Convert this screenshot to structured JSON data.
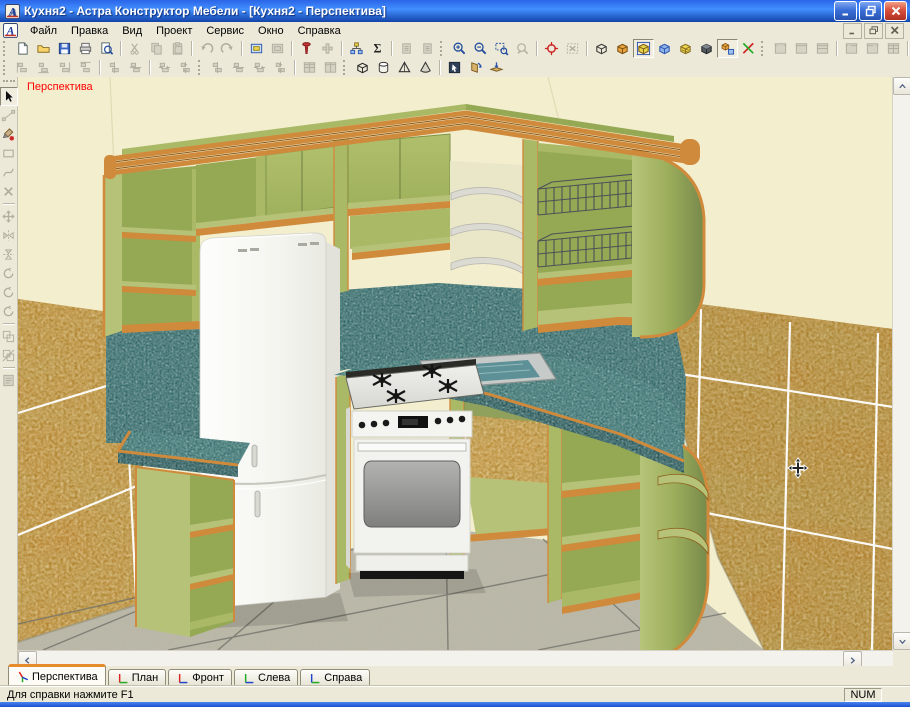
{
  "window": {
    "title": "Кухня2 - Астра Конструктор Мебели - [Кухня2 - Перспектива]"
  },
  "menu": {
    "items": [
      {
        "name": "file",
        "label": "Файл"
      },
      {
        "name": "edit",
        "label": "Правка"
      },
      {
        "name": "view",
        "label": "Вид"
      },
      {
        "name": "project",
        "label": "Проект"
      },
      {
        "name": "service",
        "label": "Сервис"
      },
      {
        "name": "window",
        "label": "Окно"
      },
      {
        "name": "help",
        "label": "Справка"
      }
    ]
  },
  "toolbars": {
    "main": [
      {
        "k": "grip"
      },
      {
        "k": "btn",
        "name": "new",
        "icon": "doc",
        "on": true
      },
      {
        "k": "btn",
        "name": "open",
        "icon": "folder",
        "on": true
      },
      {
        "k": "btn",
        "name": "save",
        "icon": "floppy",
        "on": true
      },
      {
        "k": "btn",
        "name": "print",
        "icon": "printer",
        "on": true
      },
      {
        "k": "btn",
        "name": "print-preview",
        "icon": "preview",
        "on": true
      },
      {
        "k": "sep"
      },
      {
        "k": "btn",
        "name": "cut",
        "icon": "scissors",
        "on": false
      },
      {
        "k": "btn",
        "name": "copy",
        "icon": "copy",
        "on": false
      },
      {
        "k": "btn",
        "name": "paste",
        "icon": "paste",
        "on": false
      },
      {
        "k": "sep"
      },
      {
        "k": "btn",
        "name": "undo",
        "icon": "undo",
        "on": false
      },
      {
        "k": "btn",
        "name": "redo",
        "icon": "redo",
        "on": false
      },
      {
        "k": "sep"
      },
      {
        "k": "btn",
        "name": "edit-material",
        "icon": "panel",
        "on": true
      },
      {
        "k": "btn",
        "name": "edit-material-2",
        "icon": "panel",
        "on": false
      },
      {
        "k": "sep"
      },
      {
        "k": "btn",
        "name": "fasteners",
        "icon": "screw",
        "on": true
      },
      {
        "k": "btn",
        "name": "fittings",
        "icon": "fitting",
        "on": false
      },
      {
        "k": "sep"
      },
      {
        "k": "btn",
        "name": "structure",
        "icon": "structure",
        "on": true
      },
      {
        "k": "btn",
        "name": "calc-sum",
        "icon": "sum",
        "on": true
      },
      {
        "k": "sep"
      },
      {
        "k": "btn",
        "name": "report-a",
        "icon": "doc2",
        "on": false
      },
      {
        "k": "btn",
        "name": "report-b",
        "icon": "doc2",
        "on": false
      },
      {
        "k": "grip"
      },
      {
        "k": "btn",
        "name": "zoom-in",
        "icon": "zin",
        "on": true
      },
      {
        "k": "btn",
        "name": "zoom-out",
        "icon": "zout",
        "on": true
      },
      {
        "k": "btn",
        "name": "zoom-window",
        "icon": "zwin",
        "on": true
      },
      {
        "k": "btn",
        "name": "zoom-prev",
        "icon": "zdyn",
        "on": false
      },
      {
        "k": "sep"
      },
      {
        "k": "btn",
        "name": "center-view",
        "icon": "target",
        "on": true
      },
      {
        "k": "btn",
        "name": "clear-selection",
        "icon": "delsel",
        "on": false
      },
      {
        "k": "sep"
      },
      {
        "k": "btn",
        "name": "view-wireframe",
        "icon": "cubewire",
        "on": true
      },
      {
        "k": "btn",
        "name": "view-solid",
        "icon": "cubesolid",
        "on": true
      },
      {
        "k": "btn",
        "name": "view-solid-edges",
        "icon": "cubebox",
        "on": true,
        "pressed": true
      },
      {
        "k": "btn",
        "name": "view-blue",
        "icon": "cubeblue",
        "on": true
      },
      {
        "k": "btn",
        "name": "view-textured",
        "icon": "cubehatch",
        "on": true
      },
      {
        "k": "btn",
        "name": "view-shaded",
        "icon": "cubedark",
        "on": true
      },
      {
        "k": "btn",
        "name": "view-panel",
        "icon": "cubepanel",
        "on": true,
        "pressed": true
      },
      {
        "k": "btn",
        "name": "view-axes",
        "icon": "axes",
        "on": true
      },
      {
        "k": "grip"
      },
      {
        "k": "btn",
        "name": "win-split-top",
        "icon": "win0",
        "on": false
      },
      {
        "k": "btn",
        "name": "win-split-bottom",
        "icon": "win1",
        "on": false
      },
      {
        "k": "btn",
        "name": "win-split-h",
        "icon": "win2",
        "on": false
      },
      {
        "k": "sep"
      },
      {
        "k": "btn",
        "name": "win-split-left",
        "icon": "win3",
        "on": false
      },
      {
        "k": "btn",
        "name": "win-split-right",
        "icon": "win4",
        "on": false
      },
      {
        "k": "btn",
        "name": "win-split-grid",
        "icon": "win5",
        "on": false
      },
      {
        "k": "sep"
      },
      {
        "k": "btn",
        "name": "win-cascade",
        "icon": "win6",
        "on": false
      },
      {
        "k": "btn",
        "name": "win-tile",
        "icon": "win7",
        "on": false
      },
      {
        "k": "btn",
        "name": "win-arrange",
        "icon": "win8",
        "on": false
      }
    ],
    "second": [
      {
        "k": "grip"
      },
      {
        "k": "btn",
        "name": "align-left",
        "icon": "al0",
        "on": false
      },
      {
        "k": "btn",
        "name": "align-bottom",
        "icon": "al1",
        "on": false
      },
      {
        "k": "btn",
        "name": "align-right",
        "icon": "al2",
        "on": false
      },
      {
        "k": "btn",
        "name": "align-top",
        "icon": "al3",
        "on": false
      },
      {
        "k": "sep"
      },
      {
        "k": "btn",
        "name": "center-h",
        "icon": "al4",
        "on": false
      },
      {
        "k": "btn",
        "name": "center-v",
        "icon": "al5",
        "on": false
      },
      {
        "k": "sep"
      },
      {
        "k": "btn",
        "name": "fit-width",
        "icon": "al6",
        "on": false
      },
      {
        "k": "btn",
        "name": "fit-height",
        "icon": "al7",
        "on": false
      },
      {
        "k": "grip"
      },
      {
        "k": "btn",
        "name": "distribute-1",
        "icon": "al4",
        "on": false
      },
      {
        "k": "btn",
        "name": "distribute-2",
        "icon": "al5",
        "on": false
      },
      {
        "k": "btn",
        "name": "distribute-3",
        "icon": "al6",
        "on": false
      },
      {
        "k": "btn",
        "name": "distribute-4",
        "icon": "al7",
        "on": false
      },
      {
        "k": "sep"
      },
      {
        "k": "btn",
        "name": "size-equal-1",
        "icon": "win5",
        "on": false
      },
      {
        "k": "btn",
        "name": "size-equal-2",
        "icon": "win7",
        "on": false
      },
      {
        "k": "grip"
      },
      {
        "k": "btn",
        "name": "shape-box",
        "icon": "sbox",
        "on": true
      },
      {
        "k": "btn",
        "name": "shape-cylinder",
        "icon": "scyl",
        "on": true
      },
      {
        "k": "btn",
        "name": "shape-pyramid",
        "icon": "spyr",
        "on": true
      },
      {
        "k": "btn",
        "name": "shape-cone",
        "icon": "scone",
        "on": true
      },
      {
        "k": "sep"
      },
      {
        "k": "btn",
        "name": "select-solid",
        "icon": "tselect",
        "on": true
      },
      {
        "k": "btn",
        "name": "rotate-part",
        "icon": "tdoor",
        "on": true
      },
      {
        "k": "btn",
        "name": "move-plane",
        "icon": "tplane",
        "on": true
      }
    ],
    "left": [
      {
        "k": "grip"
      },
      {
        "k": "btn",
        "name": "select",
        "icon": "rarrow",
        "on": true,
        "pressed": true
      },
      {
        "k": "btn",
        "name": "edit-points",
        "icon": "rnode",
        "on": false
      },
      {
        "k": "btn",
        "name": "paint-texture",
        "icon": "rpaint",
        "on": true
      },
      {
        "k": "btn",
        "name": "draw-rect",
        "icon": "rrect",
        "on": false
      },
      {
        "k": "btn",
        "name": "draw-curve",
        "icon": "rcurve",
        "on": false
      },
      {
        "k": "btn",
        "name": "delete",
        "icon": "rx",
        "on": false
      },
      {
        "k": "sep"
      },
      {
        "k": "btn",
        "name": "move",
        "icon": "rmove",
        "on": false
      },
      {
        "k": "btn",
        "name": "mirror-h",
        "icon": "rmir1",
        "on": false
      },
      {
        "k": "btn",
        "name": "mirror-v",
        "icon": "rmir2",
        "on": false
      },
      {
        "k": "btn",
        "name": "rotate-x",
        "icon": "rrot",
        "on": false
      },
      {
        "k": "btn",
        "name": "rotate-y",
        "icon": "rrot",
        "on": false
      },
      {
        "k": "btn",
        "name": "rotate-z",
        "icon": "rrot",
        "on": false
      },
      {
        "k": "sep"
      },
      {
        "k": "btn",
        "name": "group",
        "icon": "rgrp1",
        "on": false
      },
      {
        "k": "btn",
        "name": "ungroup",
        "icon": "rgrp2",
        "on": false
      },
      {
        "k": "sep"
      },
      {
        "k": "btn",
        "name": "properties",
        "icon": "rprops",
        "on": false
      }
    ]
  },
  "viewport": {
    "label": "Перспектива"
  },
  "tabs": [
    {
      "name": "perspective",
      "label": "Перспектива",
      "icon": "persp",
      "active": true,
      "a": "#dd2222",
      "b": "#22aa22",
      "c": "#2244cc"
    },
    {
      "name": "plan",
      "label": "План",
      "icon": "axis",
      "v": "#dd2222",
      "h": "#22aa22",
      "active": false
    },
    {
      "name": "front",
      "label": "Фронт",
      "icon": "axis",
      "v": "#dd2222",
      "h": "#2244cc",
      "active": false
    },
    {
      "name": "left-view",
      "label": "Слева",
      "icon": "axis",
      "v": "#22aa22",
      "h": "#2244cc",
      "active": false
    },
    {
      "name": "right-view",
      "label": "Справа",
      "icon": "axis",
      "v": "#2244cc",
      "h": "#22aa22",
      "active": false
    }
  ],
  "status": {
    "message": "Для справки нажмите F1",
    "indicator": "NUM"
  },
  "palette": {
    "chrome": "#ece9d8",
    "chrome_dark": "#aca899",
    "title_blue_top": "#2a65e8",
    "title_blue_mid": "#428eff",
    "title_blue_bot": "#1244a8",
    "frame_blue": "#1c4fd0",
    "wall_cream": "#f3efcf",
    "tile": "#b5812c",
    "grout": "#ffffff",
    "floor": "#bcb9a8",
    "floor_line": "#72726a",
    "teal": "#2e6160",
    "teal_light": "#38706c",
    "teal_dark": "#1d4446",
    "green_light": "#b5c277",
    "green_face": "#a9b966",
    "green_mid": "#95a955",
    "green_dark": "#7e9348",
    "orange": "#d08a3c",
    "orange_dark": "#8a5717",
    "marble": "#bd8c38",
    "fridge_white": "#f9f9f5",
    "stove_white": "#f2f2ee",
    "basket_wire": "#4b5156",
    "gray_shelf": "#dbdad3",
    "label_red": "#ff0000",
    "tab_highlight": "#e68b2c",
    "disabled_icon": "#b1ae9f"
  }
}
